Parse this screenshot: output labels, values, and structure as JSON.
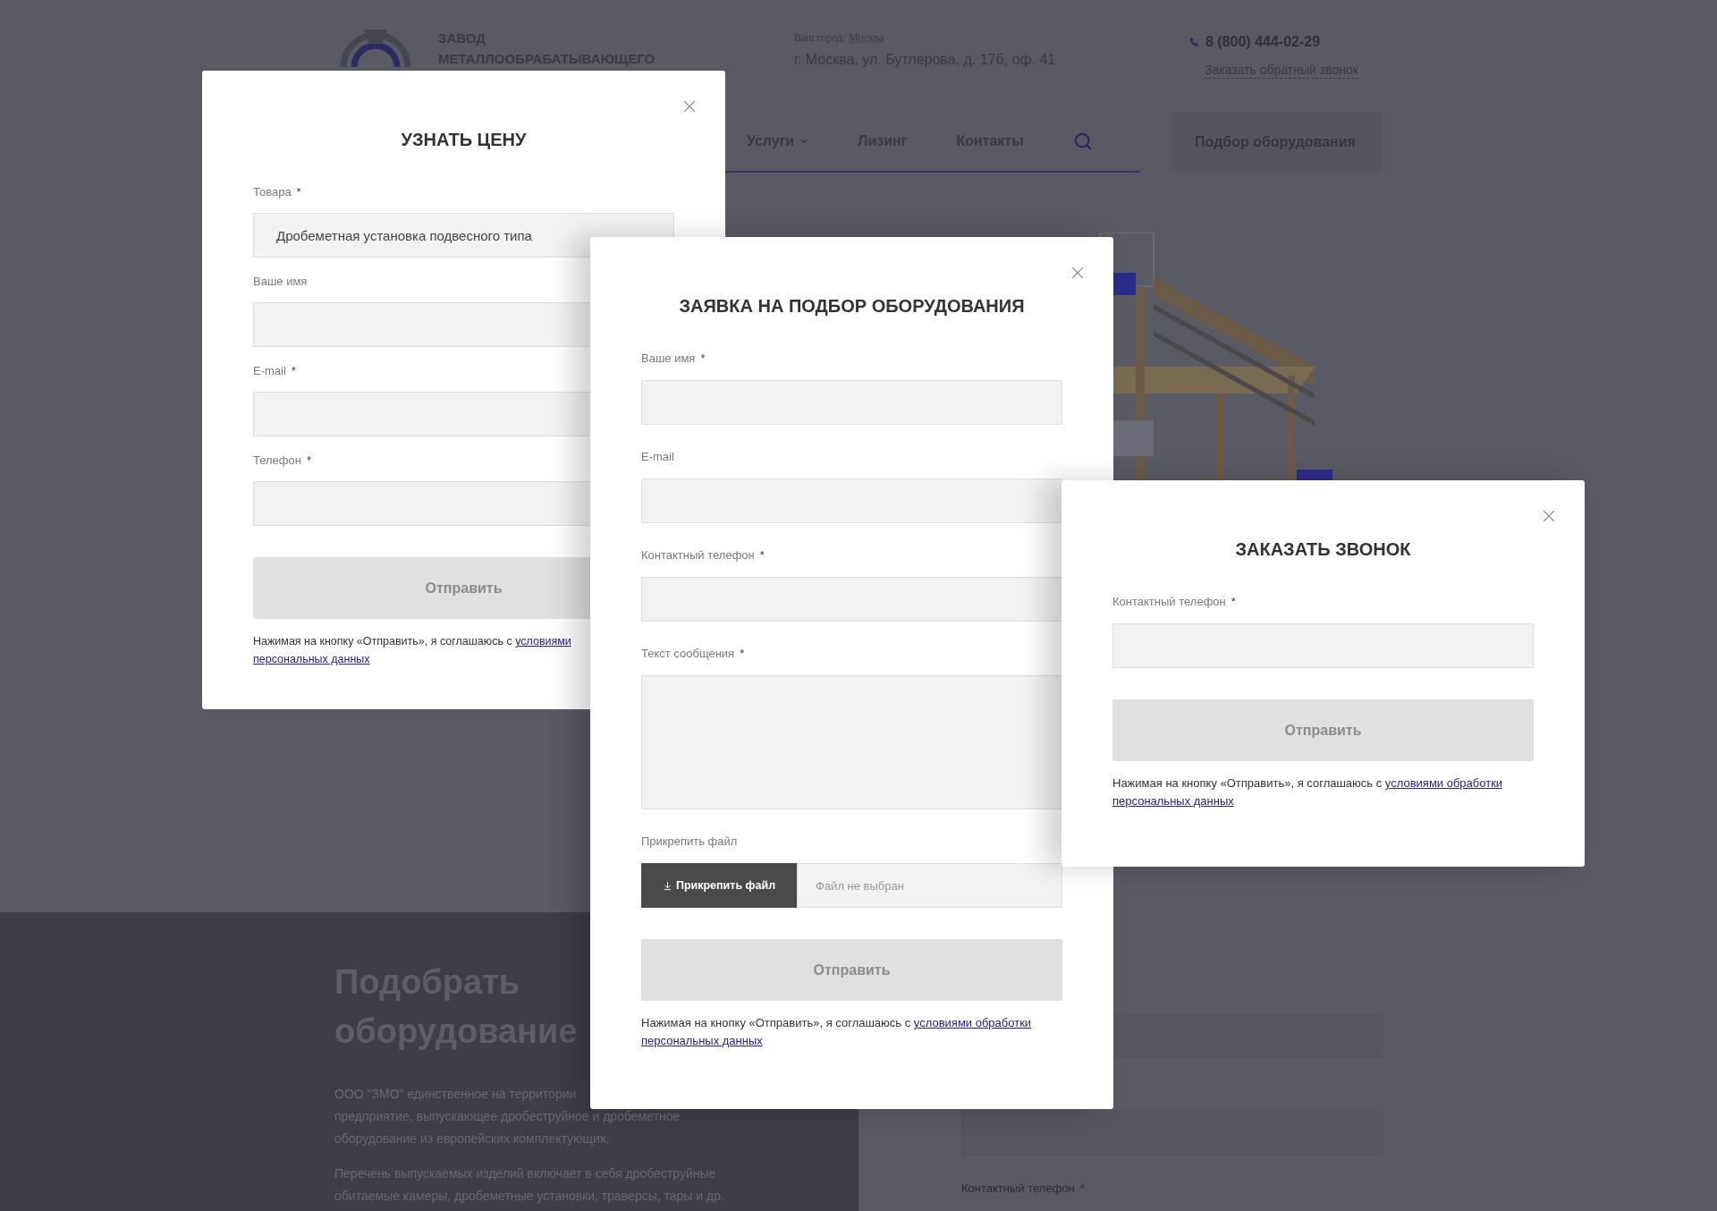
{
  "header": {
    "logo_lines": [
      "ЗАВОД",
      "МЕТАЛЛООБРАБАТЫВАЮЩЕГО"
    ],
    "city_label": "Ваш город:",
    "city": "Москва",
    "address": "г. Москва, ул. Бутлерова, д. 17б, оф. 41",
    "phone": "8 (800) 444-02-29",
    "callback_link": "Заказать обратный звонок"
  },
  "nav": {
    "items": [
      {
        "label": "Услуги",
        "has_dropdown": true
      },
      {
        "label": "Лизинг",
        "has_dropdown": false
      },
      {
        "label": "Контакты",
        "has_dropdown": false
      }
    ],
    "button": "Подбор оборудования"
  },
  "section": {
    "heading_lines": [
      "Подобрать",
      "оборудование"
    ],
    "paragraphs": [
      [
        "ООО \"ЗМО\" единственное на территории",
        "предприятие, выпускающее дробеструйное и дробеметное",
        "оборудование из европейских комплектующих."
      ],
      [
        "Перечень выпускаемых изделий включает в себя дробеструйные",
        "обитаемые камеры, дробеметные установки, траверсы, тары и др."
      ]
    ],
    "form": {
      "label": "Контактный телефон",
      "mark": "*"
    }
  },
  "modals": [
    {
      "title": "УЗНАТЬ ЦЕНУ",
      "fields": [
        {
          "kind": "input",
          "label": "Товара",
          "mark": "*",
          "value": "Дробеметная установка подвесного типа"
        },
        {
          "kind": "input",
          "label": "Ваше имя"
        },
        {
          "kind": "input",
          "label": "E-mail",
          "mark": "*"
        },
        {
          "kind": "input",
          "label": "Телефон",
          "mark": "*"
        }
      ],
      "submit": "Отправить",
      "consent": {
        "text": "Нажимая на кнопку «Отправить», я соглашаюсь с",
        "links": [
          "условиями",
          "персональных данных"
        ]
      }
    },
    {
      "title": "ЗАЯВКА НА ПОДБОР ОБОРУДОВАНИЯ",
      "fields": [
        {
          "kind": "input",
          "label": "Ваше имя",
          "mark": "*"
        },
        {
          "kind": "input",
          "label": "E-mail"
        },
        {
          "kind": "input",
          "label": "Контактный телефон",
          "mark": "*"
        },
        {
          "kind": "textarea",
          "label": "Текст сообщения",
          "mark": "*"
        },
        {
          "kind": "file",
          "label": "Прикрепить файл",
          "button": "Прикрепить файл",
          "placeholder": "Файл не выбран"
        }
      ],
      "submit": "Отправить",
      "consent": {
        "text": "Нажимая на кнопку «Отправить», я соглашаюсь с",
        "links": [
          "условиями обработки",
          "персональных данных"
        ]
      }
    },
    {
      "title": "ЗАКАЗАТЬ ЗВОНОК",
      "fields": [
        {
          "kind": "input",
          "label": "Контактный телефон",
          "mark": "*"
        }
      ],
      "submit": "Отправить",
      "consent": {
        "text": "Нажимая на кнопку «Отправить», я соглашаюсь с",
        "links": [
          "условиями обработки",
          "персональных данных"
        ]
      }
    }
  ]
}
